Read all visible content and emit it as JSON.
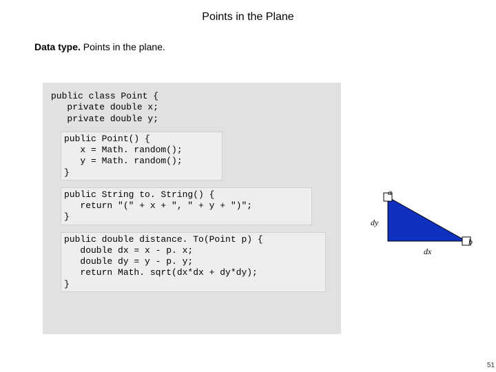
{
  "title": "Points in the Plane",
  "subtitle_bold": "Data type.",
  "subtitle_rest": "  Points in the plane.",
  "code_head": "public class Point {\n   private double x;\n   private double y;",
  "code_block1": "public Point() {\n   x = Math. random();\n   y = Math. random();\n}",
  "code_block2": "public String to. String() {\n   return \"(\" + x + \", \" + y + \")\";\n}",
  "code_block3": "public double distance. To(Point p) {\n   double dx = x - p. x;\n   double dy = y - p. y;\n   return Math. sqrt(dx*dx + dy*dy);\n}",
  "fig": {
    "a": "a",
    "b": "b",
    "dx": "dx",
    "dy": "dy"
  },
  "pagenum": "51"
}
